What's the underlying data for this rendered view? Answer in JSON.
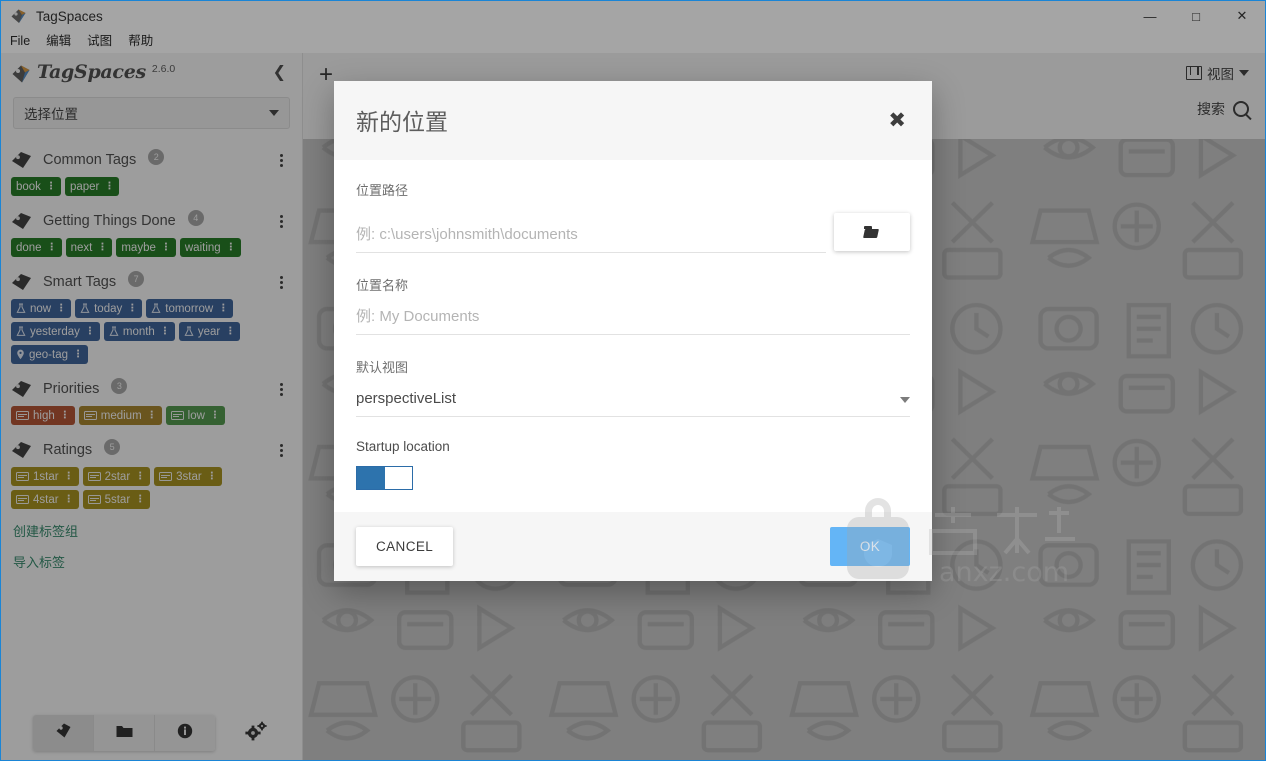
{
  "window": {
    "title": "TagSpaces",
    "controls": {
      "minimize": "—",
      "maximize": "□",
      "close": "✕"
    }
  },
  "menubar": {
    "items": [
      {
        "label": "File"
      },
      {
        "label": "编辑"
      },
      {
        "label": "试图"
      },
      {
        "label": "帮助"
      }
    ]
  },
  "sidebar": {
    "brand": {
      "name": "TagSpaces",
      "version": "2.6.0"
    },
    "collapse_icon": "❮",
    "location_select": {
      "label": "选择位置"
    },
    "tag_groups": [
      {
        "title": "Common Tags",
        "count": "2",
        "tags": [
          {
            "label": "book",
            "color": "#0f6b0f",
            "icon": "none"
          },
          {
            "label": "paper",
            "color": "#0f6b0f",
            "icon": "none"
          }
        ]
      },
      {
        "title": "Getting Things Done",
        "count": "4",
        "tags": [
          {
            "label": "done",
            "color": "#0f6b0f",
            "icon": "none"
          },
          {
            "label": "next",
            "color": "#0f6b0f",
            "icon": "none"
          },
          {
            "label": "maybe",
            "color": "#0f6b0f",
            "icon": "none"
          },
          {
            "label": "waiting",
            "color": "#0f6b0f",
            "icon": "none"
          }
        ]
      },
      {
        "title": "Smart Tags",
        "count": "7",
        "tags": [
          {
            "label": "now",
            "color": "#29518c",
            "icon": "flask"
          },
          {
            "label": "today",
            "color": "#29518c",
            "icon": "flask"
          },
          {
            "label": "tomorrow",
            "color": "#29518c",
            "icon": "flask"
          },
          {
            "label": "yesterday",
            "color": "#29518c",
            "icon": "flask"
          },
          {
            "label": "month",
            "color": "#29518c",
            "icon": "flask"
          },
          {
            "label": "year",
            "color": "#29518c",
            "icon": "flask"
          },
          {
            "label": "geo-tag",
            "color": "#29518c",
            "icon": "pin"
          }
        ]
      },
      {
        "title": "Priorities",
        "count": "3",
        "tags": [
          {
            "label": "high",
            "color": "#a8401e",
            "icon": "card"
          },
          {
            "label": "medium",
            "color": "#9a7518",
            "icon": "card"
          },
          {
            "label": "low",
            "color": "#3e8a3a",
            "icon": "card"
          }
        ]
      },
      {
        "title": "Ratings",
        "count": "5",
        "tags": [
          {
            "label": "1star",
            "color": "#9a8308",
            "icon": "card"
          },
          {
            "label": "2star",
            "color": "#9a8308",
            "icon": "card"
          },
          {
            "label": "3star",
            "color": "#9a8308",
            "icon": "card"
          },
          {
            "label": "4star",
            "color": "#9a8308",
            "icon": "card"
          },
          {
            "label": "5star",
            "color": "#9a8308",
            "icon": "card"
          }
        ]
      }
    ],
    "links": [
      {
        "label": "创建标签组"
      },
      {
        "label": "导入标签"
      }
    ],
    "footer": {
      "tag_icon": "tag-icon",
      "folder_icon": "folder-icon",
      "info_icon": "info-icon",
      "settings_icon": "gear-icon"
    }
  },
  "toolbar": {
    "add_label": "+",
    "view_label": "视图",
    "search_label": "搜索"
  },
  "dialog": {
    "title": "新的位置",
    "close_label": "✖",
    "path_field": {
      "label": "位置路径",
      "value": "",
      "placeholder": "例: c:\\users\\johnsmith\\documents"
    },
    "name_field": {
      "label": "位置名称",
      "value": "",
      "placeholder": "例: My Documents"
    },
    "perspective_field": {
      "label": "默认视图",
      "value": "perspectiveList"
    },
    "startup_toggle": {
      "label": "Startup location",
      "state": "on"
    },
    "buttons": {
      "cancel": "CANCEL",
      "ok": "OK"
    }
  },
  "watermark": {
    "text": "anxz.com"
  },
  "colors": {
    "accent_blue": "#2d73ad",
    "ok_button": "#64b5f6",
    "link_green": "#1f7a5a",
    "window_border": "#1a85d6"
  }
}
